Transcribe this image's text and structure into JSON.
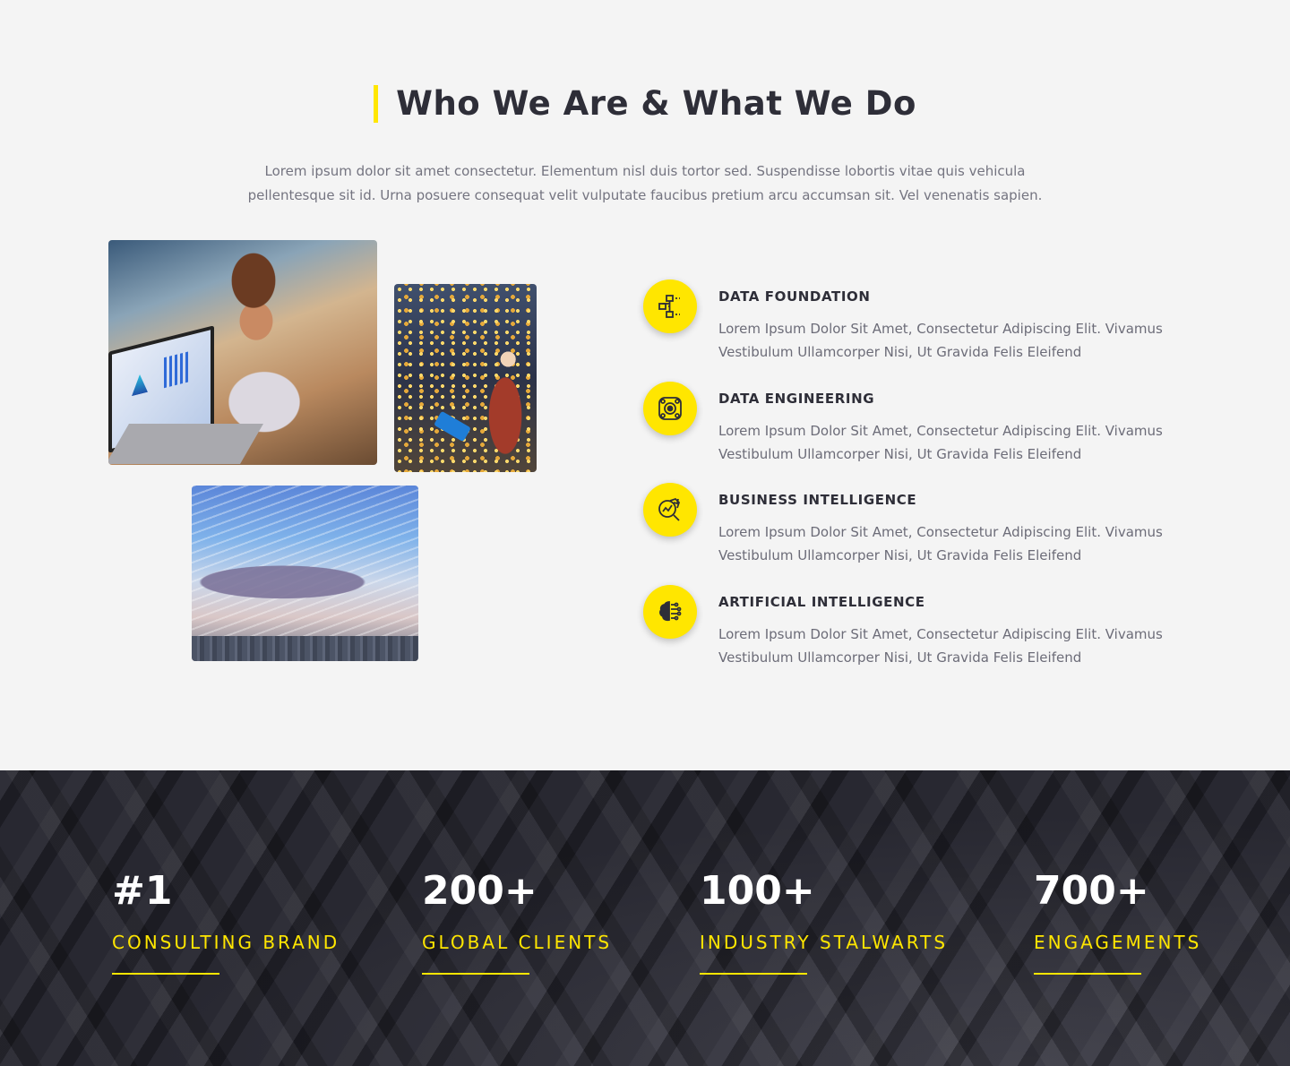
{
  "about": {
    "title": "Who We Are & What We Do",
    "intro": "Lorem ipsum dolor sit amet consectetur. Elementum nisl duis tortor sed. Suspendisse lobortis vitae quis vehicula pellentesque sit id. Urna posuere consequat velit vulputate faucibus pretium arcu accumsan sit. Vel venenatis sapien.",
    "services": [
      {
        "title": "DATA FOUNDATION",
        "icon": "data-foundation-icon",
        "description": "Lorem Ipsum Dolor Sit Amet, Consectetur Adipiscing Elit. Vivamus Vestibulum Ullamcorper Nisi, Ut Gravida Felis Eleifend"
      },
      {
        "title": "DATA ENGINEERING",
        "icon": "data-engineering-icon",
        "description": "Lorem Ipsum Dolor Sit Amet, Consectetur Adipiscing Elit. Vivamus Vestibulum Ullamcorper Nisi, Ut Gravida Felis Eleifend"
      },
      {
        "title": "BUSINESS INTELLIGENCE",
        "icon": "business-intelligence-icon",
        "description": "Lorem Ipsum Dolor Sit Amet, Consectetur Adipiscing Elit. Vivamus Vestibulum Ullamcorper Nisi, Ut Gravida Felis Eleifend"
      },
      {
        "title": "ARTIFICIAL INTELLIGENCE",
        "icon": "artificial-intelligence-icon",
        "description": "Lorem Ipsum Dolor Sit Amet, Consectetur Adipiscing Elit. Vivamus Vestibulum Ullamcorper Nisi, Ut Gravida Felis Eleifend"
      }
    ]
  },
  "stats": [
    {
      "value": "#1",
      "label": "CONSULTING BRAND"
    },
    {
      "value": "200+",
      "label": "GLOBAL CLIENTS"
    },
    {
      "value": "100+",
      "label": "INDUSTRY STALWARTS"
    },
    {
      "value": "700+",
      "label": "ENGAGEMENTS"
    }
  ],
  "colors": {
    "accent": "#ffe600",
    "dark": "#2e2e38",
    "text_muted": "#747480",
    "background": "#f4f4f4",
    "stats_background": "#24242d"
  }
}
